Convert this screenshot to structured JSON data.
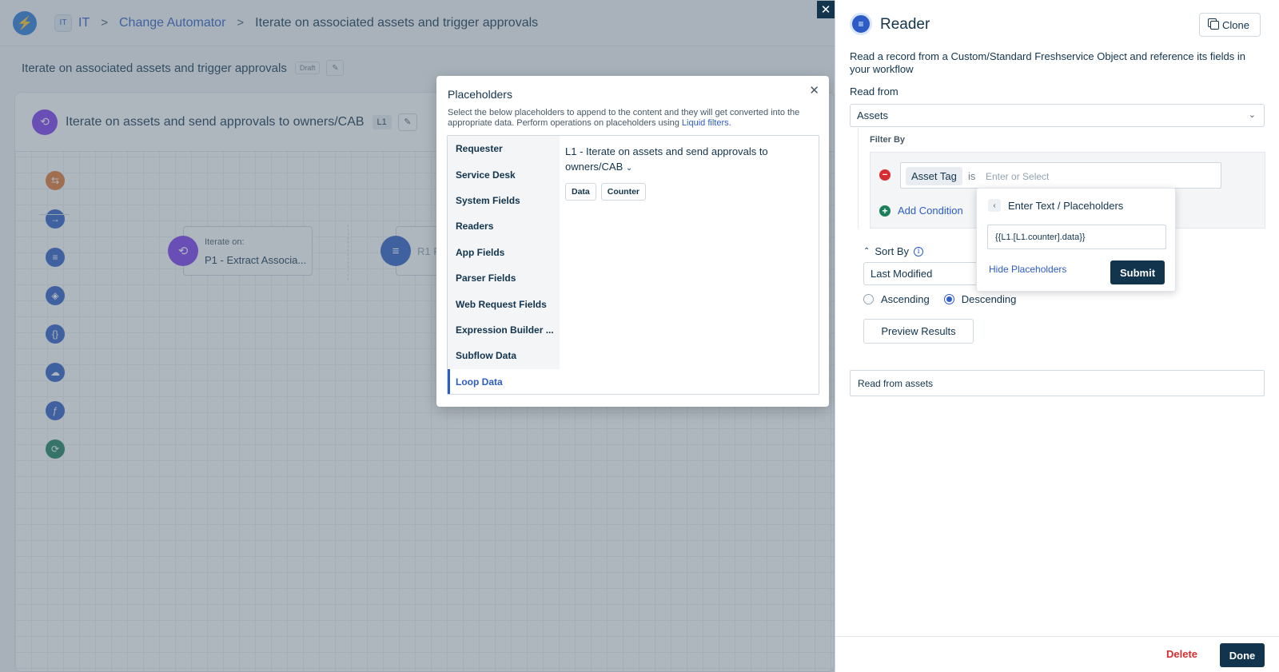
{
  "header": {
    "workspace_badge": "IT",
    "workspace_label": "IT",
    "crumb_app": "Change Automator",
    "crumb_sep": ">",
    "crumb_current": "Iterate on associated assets and trigger approvals"
  },
  "workflow": {
    "title": "Iterate on associated assets and trigger approvals",
    "status": "Draft"
  },
  "loop": {
    "title": "Iterate on assets and send approvals to owners/CAB",
    "badge": "L1"
  },
  "nodes": {
    "iterate_sub": "Iterate on:",
    "iterate_main": "P1 - Extract Associa...",
    "reader_label": "R1 R"
  },
  "placeholders_modal": {
    "title": "Placeholders",
    "description": "Select the below placeholders to append to the content and they will get converted into the appropriate data. Perform operations on placeholders using",
    "link": "Liquid filters.",
    "categories": [
      "Requester",
      "Service Desk",
      "System Fields",
      "Readers",
      "App Fields",
      "Parser Fields",
      "Web Request Fields",
      "Expression Builder ...",
      "Subflow Data",
      "Loop Data"
    ],
    "group_title": "L1 - Iterate on assets and send approvals to owners/CAB",
    "chips": [
      "Data",
      "Counter"
    ]
  },
  "reader_panel": {
    "title": "Reader",
    "clone_label": "Clone",
    "description": "Read a record from a Custom/Standard Freshservice Object and reference its fields in your workflow",
    "read_from_label": "Read from",
    "read_from_value": "Assets",
    "filter_by_label": "Filter By",
    "condition": {
      "field": "Asset Tag",
      "operator": "is",
      "placeholder": "Enter or Select"
    },
    "add_condition_label": "Add Condition",
    "sort_by_label": "Sort By",
    "sort_by_value": "Last Modified",
    "ascending_label": "Ascending",
    "descending_label": "Descending",
    "sort_order": "Descending",
    "preview_label": "Preview Results",
    "name_value": "Read from assets",
    "delete_label": "Delete",
    "done_label": "Done"
  },
  "popover": {
    "title": "Enter Text / Placeholders",
    "input_value": "{{L1.[L1.counter].data}}",
    "hide_label": "Hide Placeholders",
    "submit_label": "Submit"
  },
  "colors": {
    "primary_navy": "#12344d",
    "link_blue": "#2c5cc5",
    "danger_red": "#d72d30",
    "loop_purple": "#7c3aed"
  },
  "icons": {
    "logo": "lightning-icon",
    "clone": "copy-icon",
    "close": "close-icon",
    "reader": "reader-icon"
  }
}
